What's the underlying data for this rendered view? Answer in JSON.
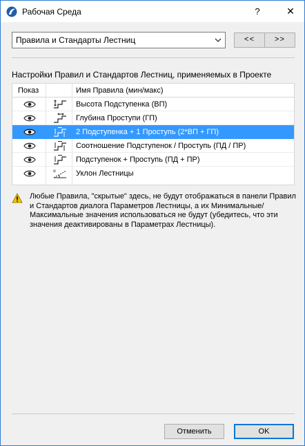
{
  "window": {
    "title": "Рабочая Среда",
    "help_glyph": "?",
    "close_glyph": "✕"
  },
  "selector": {
    "selected_value": "Правила и Стандарты Лестниц",
    "prev_label": "<<",
    "next_label": ">>"
  },
  "section": {
    "label": "Настройки Правил и Стандартов Лестниц, применяемых в Проекте"
  },
  "table": {
    "headers": {
      "show": "Показ",
      "name": "Имя Правила (мин/макс)"
    },
    "rows": [
      {
        "name": "Высота Подступенка (ВП)",
        "icon": "riser-height-icon",
        "selected": false
      },
      {
        "name": "Глубина Проступи (ГП)",
        "icon": "tread-depth-icon",
        "selected": false
      },
      {
        "name": "2 Подступенка + 1 Проступь (2*ВП + ГП)",
        "icon": "riser-tread-formula-icon",
        "selected": true
      },
      {
        "name": "Соотношение Подступенок / Проступь (ПД / ПР)",
        "icon": "riser-tread-ratio-icon",
        "selected": false
      },
      {
        "name": "Подступенок + Проступь (ПД + ПР)",
        "icon": "riser-plus-tread-icon",
        "selected": false
      },
      {
        "name": "Уклон Лестницы",
        "icon": "stair-slope-icon",
        "selected": false
      }
    ]
  },
  "warning": {
    "icon": "warning-icon",
    "text": "Любые Правила, \"скрытые\" здесь, не будут отображаться в панели Правил и Стандартов диалога Параметров Лестницы, а их Минимальные/Максимальные значения использоваться не будут (убедитесь, что эти значения деактивированы в Параметрах Лестницы)."
  },
  "footer": {
    "cancel_label": "Отменить",
    "ok_label": "OK"
  },
  "colors": {
    "selection": "#3399ff",
    "window_border": "#2d7bd1",
    "warning": "#f5c400"
  }
}
